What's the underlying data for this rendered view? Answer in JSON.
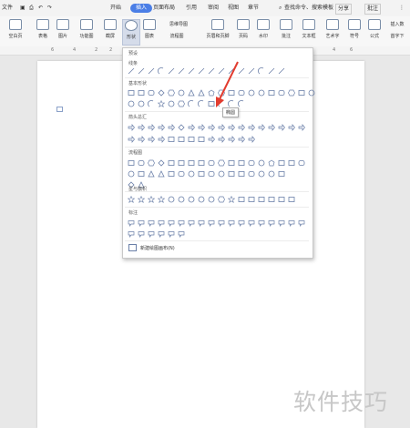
{
  "menubar": {
    "items": [
      "文件",
      "开始",
      "插入",
      "页面布局",
      "引用",
      "审阅",
      "视图",
      "章节"
    ],
    "active": "插入",
    "search_placeholder": "查找命令、搜索模板",
    "share": "分享",
    "annotate": "批注"
  },
  "ribbon": {
    "buttons": [
      "空白页",
      "表格",
      "图片",
      "功能图",
      "截屏",
      "形状",
      "图表",
      "思维导图",
      "流程图",
      "页眉和页脚",
      "页码",
      "水印",
      "批注",
      "文本框",
      "艺术字",
      "符号",
      "公式",
      "插入数",
      "首字下"
    ]
  },
  "ruler": {
    "ticks": [
      "6",
      "4",
      "2",
      "2",
      "4",
      "6"
    ]
  },
  "dropdown": {
    "title": "预设",
    "sections": [
      "线条",
      "基本形状",
      "箭头总汇",
      "流程图",
      "星与旗帜",
      "标注"
    ],
    "footer": "新建绘图画布(N)",
    "tooltip": "椭圆"
  },
  "watermark": "软件技巧",
  "colors": {
    "accent": "#4a7ee6",
    "arrow": "#e23c2f",
    "shape_stroke": "#6a7fa8"
  }
}
